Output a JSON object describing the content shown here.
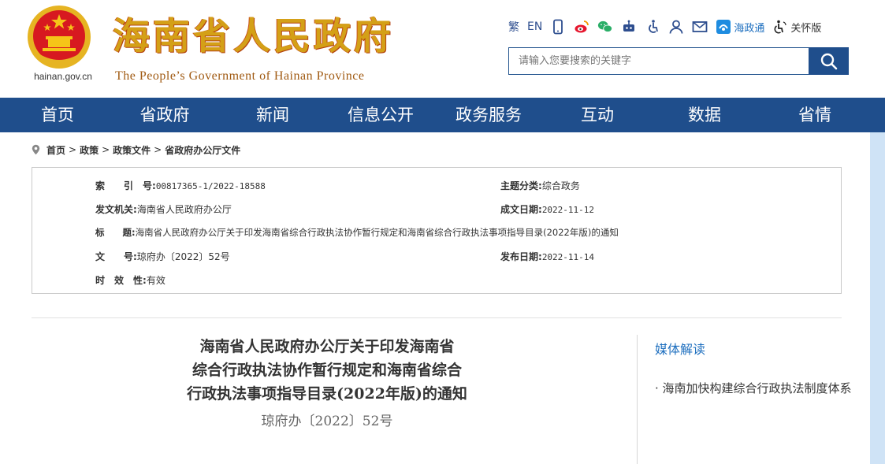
{
  "header": {
    "site_title": "海南省人民政府",
    "site_subtitle": "The People’s Government  of Hainan Province",
    "domain": "hainan.gov.cn",
    "tools": {
      "traditional": "繁",
      "english": "EN",
      "hainan_app": "海政通",
      "care_mode": "关怀版"
    },
    "search": {
      "placeholder": "请输入您要搜索的关键字"
    }
  },
  "nav": {
    "items": [
      "首页",
      "省政府",
      "新闻",
      "信息公开",
      "政务服务",
      "互动",
      "数据",
      "省情"
    ]
  },
  "breadcrumb": {
    "items": [
      "首页",
      "政策",
      "政策文件",
      "省政府办公厅文件"
    ],
    "separator": ">"
  },
  "info": {
    "index_label": "索　　引　号:",
    "index_value": "00817365-1/2022-18588",
    "category_label": "主题分类:",
    "category_value": "综合政务",
    "issuer_label": "发文机关:",
    "issuer_value": "海南省人民政府办公厅",
    "date_written_label": "成文日期:",
    "date_written_value": "2022-11-12",
    "title_label": "标　　题:",
    "title_value": "海南省人民政府办公厅关于印发海南省综合行政执法协作暂行规定和海南省综合行政执法事项指导目录(2022年版)的通知",
    "doc_number_label": "文　　号:",
    "doc_number_value": "琼府办〔2022〕52号",
    "publish_date_label": "发布日期:",
    "publish_date_value": "2022-11-14",
    "validity_label": "时　效　性:",
    "validity_value": "有效"
  },
  "article": {
    "title_line1": "海南省人民政府办公厅关于印发海南省",
    "title_line2": "综合行政执法协作暂行规定和海南省综合",
    "title_line3": "行政执法事项指导目录(2022年版)的通知",
    "doc_number": "琼府办〔2022〕52号"
  },
  "sidebar": {
    "title": "媒体解读",
    "link": "· 海南加快构建综合行政执法制度体系"
  },
  "colors": {
    "nav_bg": "#1f4e8c",
    "title_gold": "#d4a017",
    "link_blue": "#1e6fbf"
  }
}
